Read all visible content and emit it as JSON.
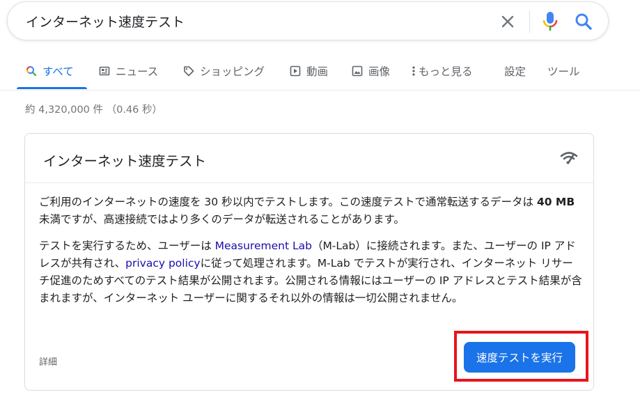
{
  "search": {
    "query": "インターネット速度テスト"
  },
  "tabs": [
    {
      "label": "すべて",
      "icon": "search-icon",
      "active": true
    },
    {
      "label": "ニュース",
      "icon": "news-icon",
      "active": false
    },
    {
      "label": "ショッピング",
      "icon": "tag-icon",
      "active": false
    },
    {
      "label": "動画",
      "icon": "play-icon",
      "active": false
    },
    {
      "label": "画像",
      "icon": "image-icon",
      "active": false
    },
    {
      "label": "もっと見る",
      "icon": "more-vert-icon",
      "active": false
    },
    {
      "label": "設定",
      "icon": "",
      "active": false
    },
    {
      "label": "ツール",
      "icon": "",
      "active": false
    }
  ],
  "result_stats": "約 4,320,000 件 （0.46 秒）",
  "card": {
    "title": "インターネット速度テスト",
    "para1": {
      "part1": "ご利用のインターネットの速度を 30 秒以内でテストします。この速度テストで通常転送するデータは ",
      "bold": "40 MB",
      "part2": " 未満ですが、高速接続ではより多くのデータが転送されることがあります。"
    },
    "para2": {
      "part1": "テストを実行するため、ユーザーは ",
      "link1": "Measurement Lab",
      "part2": "（M-Lab）に接続されます。また、ユーザーの IP アドレスが共有され、",
      "link2": "privacy policy",
      "part3": "に従って処理されます。M-Lab でテストが実行され、インターネット リサーチ促進のためすべてのテスト結果が公開されます。公開される情報にはユーザーの IP アドレスとテスト結果が含まれますが、インターネット ユーザーに関するそれ以外の情報は一切公開されません。"
    },
    "details_label": "詳細",
    "run_button_label": "速度テストを実行"
  },
  "colors": {
    "accent": "#1a73e8",
    "link": "#1a0dab",
    "highlight": "#e8141c",
    "mic_blue": "#4285f4",
    "mic_red": "#ea4335",
    "mic_yellow": "#fbbc05",
    "mic_green": "#34a853"
  }
}
